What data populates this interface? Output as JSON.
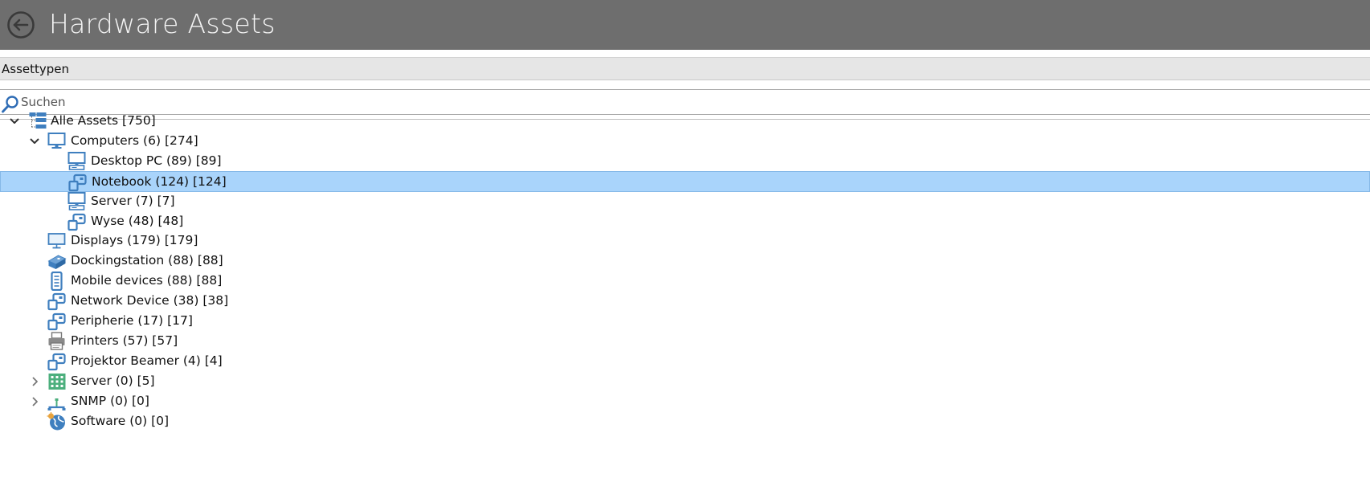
{
  "header": {
    "title": "Hardware Assets",
    "back_icon": "back-arrow-circle-icon"
  },
  "section": {
    "label": "Assettypen"
  },
  "search": {
    "placeholder": "Suchen",
    "value": "",
    "icon": "search-icon"
  },
  "colors": {
    "titlebar": "#6e6e6e",
    "selection": "#a9d4fb",
    "icon_blue": "#3f7fbf",
    "icon_green": "#4caf7d"
  },
  "tree": {
    "items": [
      {
        "label": "Alle Assets [750]",
        "level": 0,
        "expander": "expanded",
        "icon": "tree-hierarchy-icon"
      },
      {
        "label": "Computers (6) [274]",
        "level": 1,
        "expander": "expanded",
        "icon": "computer-monitor-icon"
      },
      {
        "label": "Desktop PC (89) [89]",
        "level": 2,
        "expander": "none",
        "icon": "desktop-pc-icon"
      },
      {
        "label": "Notebook (124) [124]",
        "level": 2,
        "expander": "none",
        "icon": "device-generic-icon",
        "selected": true
      },
      {
        "label": "Server (7) [7]",
        "level": 2,
        "expander": "none",
        "icon": "server-monitor-icon"
      },
      {
        "label": "Wyse (48) [48]",
        "level": 2,
        "expander": "none",
        "icon": "device-generic-icon"
      },
      {
        "label": "Displays (179) [179]",
        "level": 1,
        "expander": "none",
        "icon": "display-icon"
      },
      {
        "label": "Dockingstation (88) [88]",
        "level": 1,
        "expander": "none",
        "icon": "docking-station-icon"
      },
      {
        "label": "Mobile devices (88) [88]",
        "level": 1,
        "expander": "none",
        "icon": "mobile-device-icon"
      },
      {
        "label": "Network Device (38) [38]",
        "level": 1,
        "expander": "none",
        "icon": "device-generic-icon"
      },
      {
        "label": "Peripherie (17) [17]",
        "level": 1,
        "expander": "none",
        "icon": "device-generic-icon"
      },
      {
        "label": "Printers (57) [57]",
        "level": 1,
        "expander": "none",
        "icon": "printer-icon"
      },
      {
        "label": "Projektor Beamer (4) [4]",
        "level": 1,
        "expander": "none",
        "icon": "device-generic-icon"
      },
      {
        "label": "Server (0) [5]",
        "level": 1,
        "expander": "collapsed",
        "icon": "server-grid-icon"
      },
      {
        "label": "SNMP (0) [0]",
        "level": 1,
        "expander": "collapsed",
        "icon": "snmp-network-icon"
      },
      {
        "label": "Software (0) [0]",
        "level": 1,
        "expander": "none",
        "icon": "software-globe-icon"
      }
    ]
  }
}
